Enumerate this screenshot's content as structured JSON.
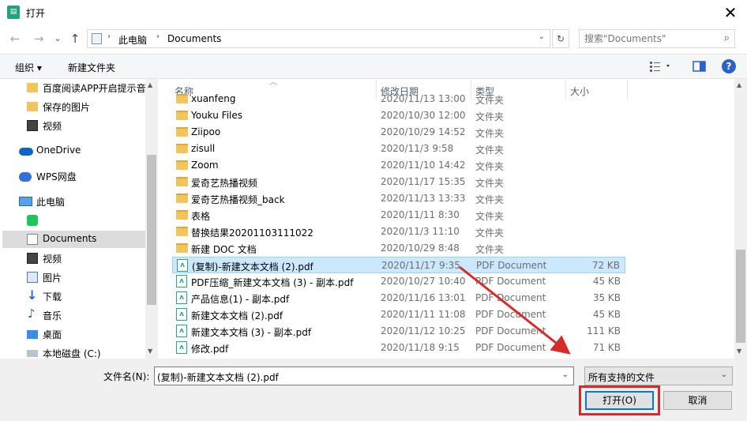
{
  "window": {
    "title": "打开",
    "close": "✕"
  },
  "nav": {
    "back": "←",
    "forward": "→",
    "dropdown": "⌄",
    "up": "↑",
    "crumb_sep": "›",
    "crumbs": [
      "此电脑",
      "Documents"
    ],
    "refresh": "↻",
    "search_placeholder": "搜索\"Documents\""
  },
  "toolbar": {
    "organize": "组织 ▾",
    "new_folder": "新建文件夹",
    "help": "?"
  },
  "sidebar": {
    "items": [
      {
        "label": "百度阅读APP开启提示音",
        "icon": "folder-icon"
      },
      {
        "label": "保存的图片",
        "icon": "folder-icon"
      },
      {
        "label": "视频",
        "icon": "video-icon"
      },
      {
        "label": "OneDrive",
        "icon": "cloud-icon"
      },
      {
        "label": "WPS网盘",
        "icon": "wps-cloud-icon"
      },
      {
        "label": "此电脑",
        "icon": "pc-icon"
      },
      {
        "label": "",
        "icon": "green-app-icon"
      },
      {
        "label": "Documents",
        "icon": "documents-icon",
        "selected": true
      },
      {
        "label": "视频",
        "icon": "video-icon"
      },
      {
        "label": "图片",
        "icon": "pictures-icon"
      },
      {
        "label": "下载",
        "icon": "download-icon"
      },
      {
        "label": "音乐",
        "icon": "music-icon"
      },
      {
        "label": "桌面",
        "icon": "desktop-icon"
      },
      {
        "label": "本地磁盘 (C:)",
        "icon": "drive-icon"
      }
    ]
  },
  "columns": {
    "name": "名称",
    "date": "修改日期",
    "type": "类型",
    "size": "大小"
  },
  "files": [
    {
      "name": "xuanfeng",
      "date": "2020/11/13 13:00",
      "type": "文件夹",
      "size": "",
      "kind": "folder"
    },
    {
      "name": "Youku Files",
      "date": "2020/10/30 12:00",
      "type": "文件夹",
      "size": "",
      "kind": "folder"
    },
    {
      "name": "Ziipoo",
      "date": "2020/10/29 14:52",
      "type": "文件夹",
      "size": "",
      "kind": "folder"
    },
    {
      "name": "zisull",
      "date": "2020/11/3 9:58",
      "type": "文件夹",
      "size": "",
      "kind": "folder"
    },
    {
      "name": "Zoom",
      "date": "2020/11/10 14:42",
      "type": "文件夹",
      "size": "",
      "kind": "folder"
    },
    {
      "name": "爱奇艺热播视频",
      "date": "2020/11/17 15:35",
      "type": "文件夹",
      "size": "",
      "kind": "folder"
    },
    {
      "name": "爱奇艺热播视频_back",
      "date": "2020/11/13 13:33",
      "type": "文件夹",
      "size": "",
      "kind": "folder"
    },
    {
      "name": "表格",
      "date": "2020/11/11 8:30",
      "type": "文件夹",
      "size": "",
      "kind": "folder"
    },
    {
      "name": "替换结果20201103111022",
      "date": "2020/11/3 11:10",
      "type": "文件夹",
      "size": "",
      "kind": "folder"
    },
    {
      "name": "新建 DOC 文档",
      "date": "2020/10/29 8:48",
      "type": "文件夹",
      "size": "",
      "kind": "folder"
    },
    {
      "name": "(复制)-新建文本文档 (2).pdf",
      "date": "2020/11/17 9:35",
      "type": "PDF Document",
      "size": "72 KB",
      "kind": "pdf",
      "selected": true
    },
    {
      "name": "PDF压缩_新建文本文档 (3) - 副本.pdf",
      "date": "2020/10/27 10:40",
      "type": "PDF Document",
      "size": "45 KB",
      "kind": "pdf"
    },
    {
      "name": "产品信息(1) - 副本.pdf",
      "date": "2020/11/16 13:01",
      "type": "PDF Document",
      "size": "35 KB",
      "kind": "pdf"
    },
    {
      "name": "新建文本文档 (2).pdf",
      "date": "2020/11/11 11:08",
      "type": "PDF Document",
      "size": "45 KB",
      "kind": "pdf"
    },
    {
      "name": "新建文本文档 (3) - 副本.pdf",
      "date": "2020/11/12 10:25",
      "type": "PDF Document",
      "size": "111 KB",
      "kind": "pdf"
    },
    {
      "name": "修改.pdf",
      "date": "2020/11/18 9:15",
      "type": "PDF Document",
      "size": "71 KB",
      "kind": "pdf"
    }
  ],
  "bottom": {
    "filename_label": "文件名(N):",
    "filename_value": "(复制)-新建文本文档 (2).pdf",
    "filter_value": "所有支持的文件",
    "open_label": "打开(O)",
    "cancel_label": "取消"
  },
  "colors": {
    "selection": "#cce8ff",
    "accent": "#0078d7",
    "annotation": "#d52b2b",
    "folder": "#f2c55c",
    "pdf": "#2aa57e"
  }
}
